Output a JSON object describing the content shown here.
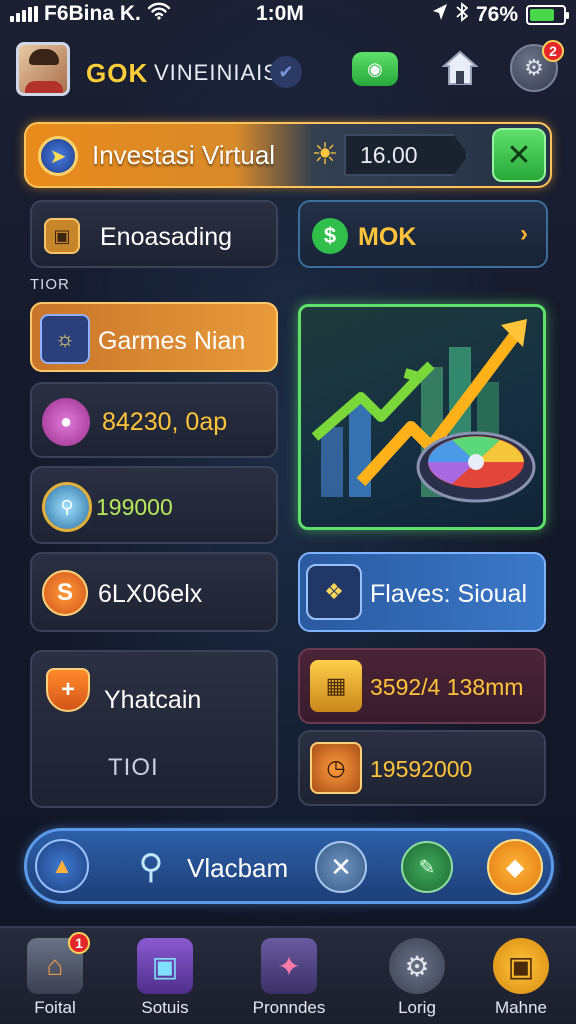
{
  "status_bar": {
    "carrier": "F6Bina K.",
    "time": "1:0M",
    "battery": "76%",
    "signal_icon": "signal-bars-icon",
    "wifi_icon": "wifi-icon",
    "bluetooth_icon": "bluetooth-icon",
    "location_icon": "location-arrow-icon"
  },
  "header": {
    "brand": "GOK",
    "username": "VINEINIAISI",
    "profile_badge": "2",
    "icons": [
      "avatar",
      "verify-icon",
      "chat-icon",
      "home-icon",
      "profile-icon"
    ]
  },
  "banner": {
    "title": "Investasi Virtual",
    "value": "16.00",
    "close_icon": "close-icon"
  },
  "cards": {
    "encoding": "Enoasading",
    "mok": "MOK",
    "section_label": "TIOR",
    "games": "Garmes Nian",
    "stat1": "84230, 0ap",
    "stat2": "199000",
    "item6": "6LX06elx",
    "flaves": "Flaves: Sioual",
    "whatcain": "Yhatcain",
    "whatcain_sub": "TIOI",
    "stat3": "3592/4 138mm",
    "stat4": "19592000"
  },
  "search": {
    "text": "Vlacbam"
  },
  "nav": [
    {
      "label": "Foital",
      "icon": "home-icon",
      "badge": "1"
    },
    {
      "label": "Sotuis",
      "icon": "gallery-icon",
      "badge": ""
    },
    {
      "label": "Pronndes",
      "icon": "tools-icon",
      "badge": ""
    },
    {
      "label": "Lorig",
      "icon": "gear-icon",
      "badge": ""
    },
    {
      "label": "Mahne",
      "icon": "shop-icon",
      "badge": ""
    }
  ],
  "colors": {
    "accent_orange": "#e98b1c",
    "accent_green": "#5fe06a",
    "accent_blue": "#2d5fa8",
    "gold_text": "#ffc43a",
    "background": "#151a2b"
  }
}
